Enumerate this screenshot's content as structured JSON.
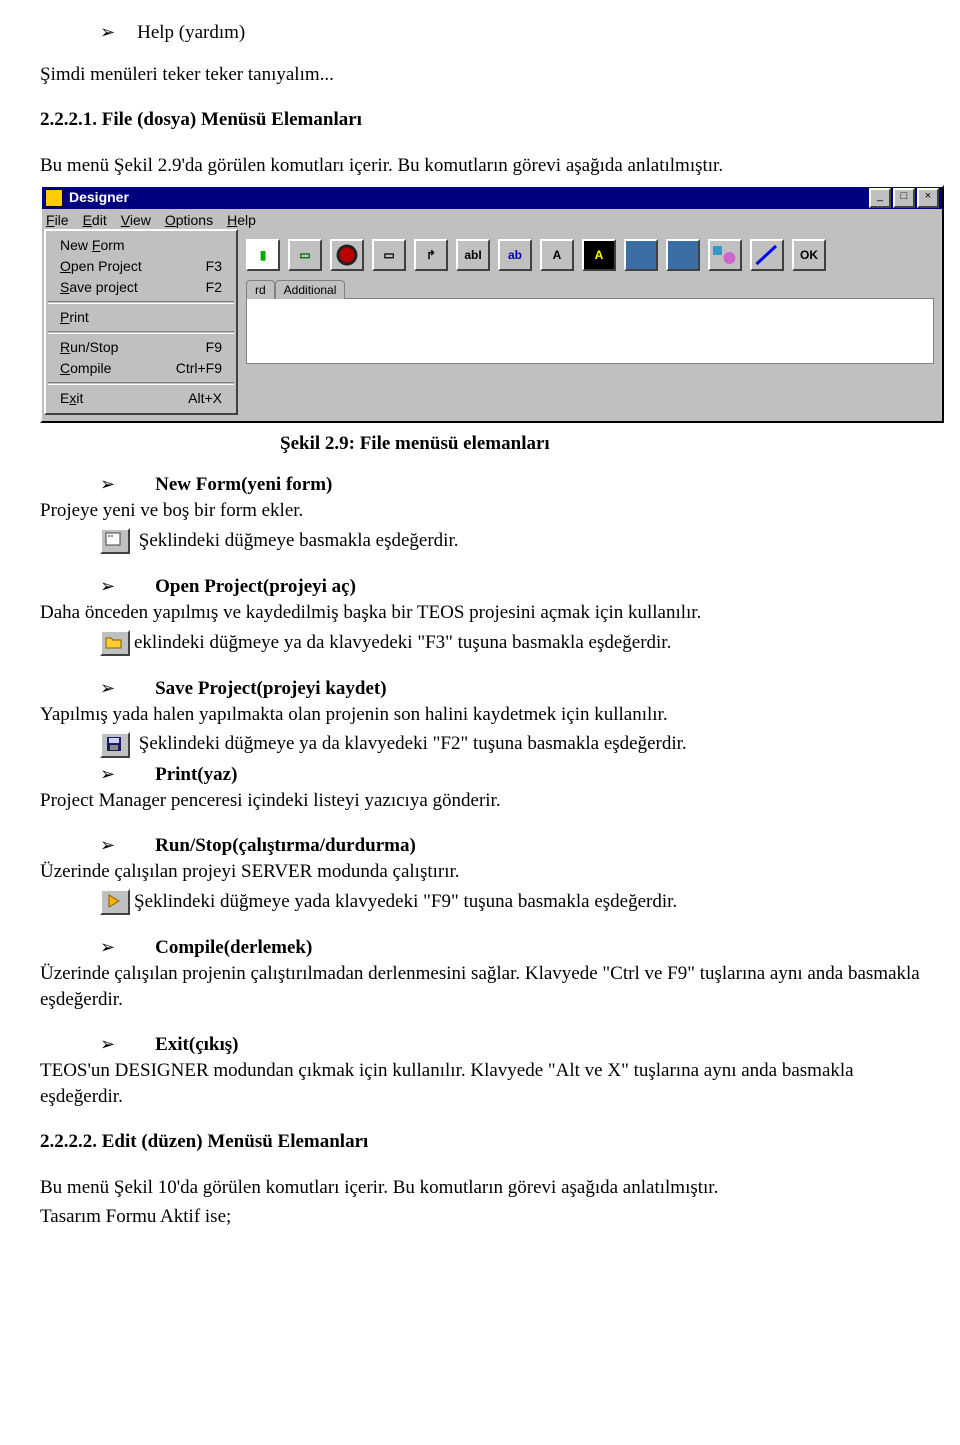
{
  "intro": {
    "help": "Help (yardım)",
    "l1": "Şimdi menüleri teker teker tanıyalım...",
    "h1": "2.2.2.1.  File (dosya) Menüsü Elemanları",
    "l2": "Bu menü Şekil 2.9'da görülen komutları içerir. Bu komutların görevi aşağıda anlatılmıştır."
  },
  "win": {
    "title": "Designer",
    "menus": {
      "file": "File",
      "edit": "Edit",
      "view": "View",
      "options": "Options",
      "help": "Help"
    },
    "dd": {
      "newform": "New Form",
      "newform_u": "F",
      "open": "Open Project",
      "open_sc": "F3",
      "open_u": "O",
      "save": "Save project",
      "save_sc": "F2",
      "save_u": "S",
      "print": "Print",
      "print_u": "P",
      "run": "Run/Stop",
      "run_sc": "F9",
      "run_u": "R",
      "compile": "Compile",
      "compile_sc": "Ctrl+F9",
      "compile_u": "C",
      "exit": "Exit",
      "exit_sc": "Alt+X",
      "exit_u": "x"
    },
    "tab1": "rd",
    "tab2": "Additional",
    "tbtns": {
      "abI": "abI",
      "ab": "ab",
      "A1": "A",
      "A2": "A",
      "ok": "OK"
    }
  },
  "caption": "Şekil 2.9: File menüsü elemanları",
  "sec": {
    "newform_h": "New Form(yeni form)",
    "newform_1": "Projeye yeni ve boş bir form ekler.",
    "newform_2": "Şeklindeki düğmeye basmakla eşdeğerdir.",
    "open_h": "Open Project(projeyi aç)",
    "open_1": "Daha önceden yapılmış ve kaydedilmiş başka bir TEOS projesini açmak  için kullanılır.",
    "open_2": "eklindeki düğmeye ya da klavyedeki \"F3\" tuşuna basmakla eşdeğerdir.",
    "save_h": "Save Project(projeyi kaydet)",
    "save_1": "Yapılmış yada halen yapılmakta olan projenin son halini kaydetmek için kullanılır.",
    "save_2": "Şeklindeki düğmeye ya da klavyedeki \"F2\" tuşuna basmakla eşdeğerdir.",
    "print_h": "Print(yaz)",
    "print_1": "Project Manager penceresi içindeki listeyi yazıcıya gönderir.",
    "run_h": "Run/Stop(çalıştırma/durdurma)",
    "run_1": "Üzerinde çalışılan projeyi SERVER modunda çalıştırır.",
    "run_2": "Şeklindeki düğmeye yada klavyedeki  \"F9\" tuşuna basmakla eşdeğerdir.",
    "compile_h": "Compile(derlemek)",
    "compile_1": "Üzerinde çalışılan projenin çalıştırılmadan derlenmesini sağlar. Klavyede \"Ctrl ve F9\" tuşlarına aynı anda basmakla eşdeğerdir.",
    "exit_h": "Exit(çıkış)",
    "exit_1": "TEOS'un DESIGNER modundan çıkmak için kullanılır. Klavyede \"Alt ve  X\" tuşlarına aynı anda basmakla eşdeğerdir."
  },
  "outro": {
    "h2": "2.2.2.2.  Edit (düzen) Menüsü Elemanları",
    "l1": "Bu menü Şekil 10'da görülen komutları içerir. Bu komutların görevi aşağıda anlatılmıştır.",
    "l2": "Tasarım Formu Aktif  ise;"
  }
}
